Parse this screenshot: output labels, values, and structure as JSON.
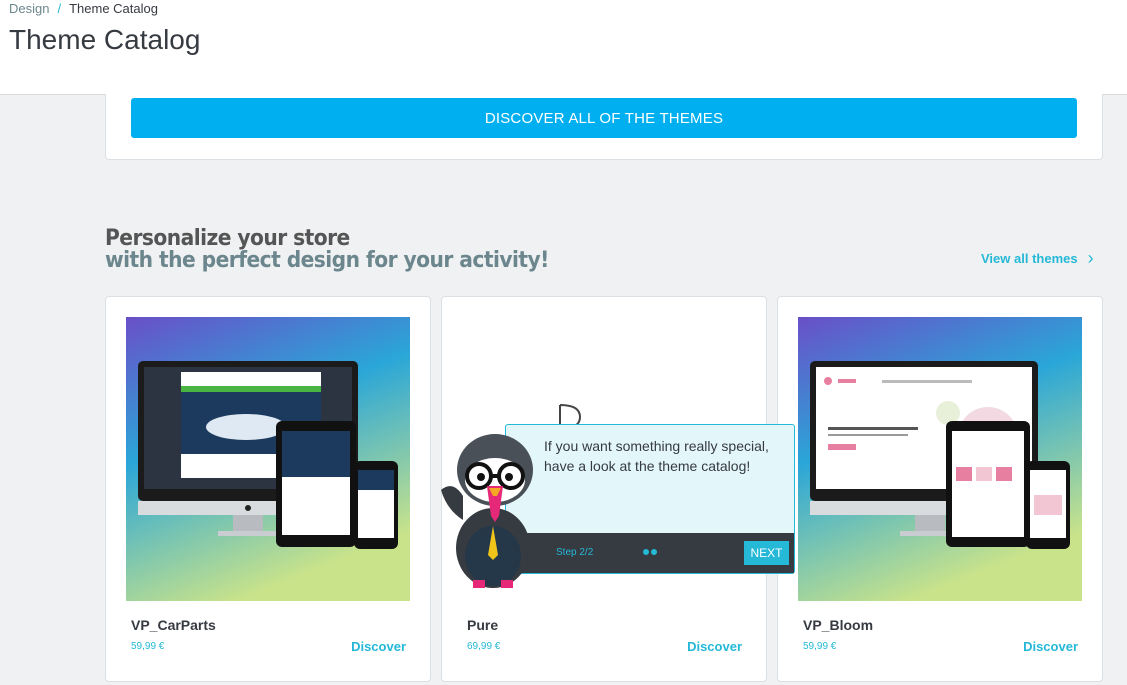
{
  "breadcrumb": {
    "parent": "Design",
    "current": "Theme Catalog"
  },
  "page_title": "Theme Catalog",
  "discover_all_button": "DISCOVER ALL OF THE THEMES",
  "promo": {
    "line1": "Personalize your store",
    "line2": "with the perfect design for your activity!",
    "view_all": "View all themes"
  },
  "themes": [
    {
      "name": "VP_CarParts",
      "price": "59,99 €",
      "action": "Discover"
    },
    {
      "name": "Pure",
      "price": "69,99 €",
      "action": "Discover"
    },
    {
      "name": "VP_Bloom",
      "price": "59,99 €",
      "action": "Discover"
    }
  ],
  "onboarding": {
    "text": "If you want something really special, have a look at the theme catalog!",
    "step": "Step 2/2",
    "next": "NEXT"
  },
  "colors": {
    "accent": "#25b9d7",
    "primary_button": "#00aff0",
    "background": "#eff1f2"
  }
}
